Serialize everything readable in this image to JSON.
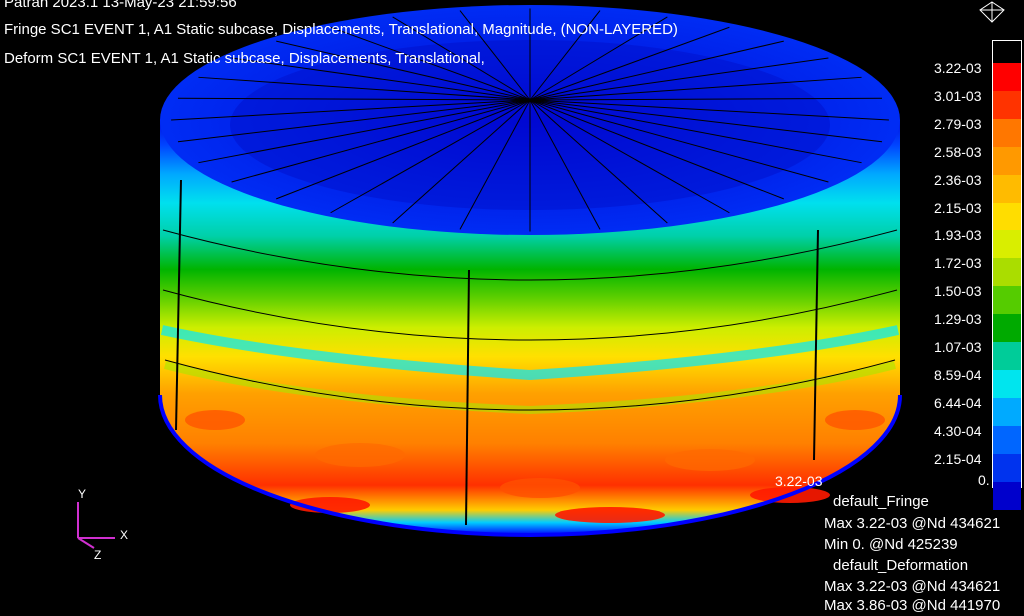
{
  "header": {
    "line1": "Patran 2023.1 13-May-23 21:59:56",
    "line2": "Fringe  SC1 EVENT 1, A1 Static subcase, Displacements, Translational, Magnitude, (NON-LAYERED)",
    "line3": "Deform  SC1 EVENT 1, A1 Static subcase, Displacements, Translational,"
  },
  "legend": {
    "labels": [
      "3.22-03",
      "3.01-03",
      "2.79-03",
      "2.58-03",
      "2.36-03",
      "2.15-03",
      "1.93-03",
      "1.72-03",
      "1.50-03",
      "1.29-03",
      "1.07-03",
      "8.59-04",
      "6.44-04",
      "4.30-04",
      "2.15-04",
      "0."
    ],
    "colors": [
      "#ff0000",
      "#ff3300",
      "#ff7700",
      "#ff9900",
      "#ffbb00",
      "#ffdd00",
      "#d9ee00",
      "#aadd00",
      "#55cc00",
      "#00aa00",
      "#00cc99",
      "#00e5ee",
      "#00aaff",
      "#0066ff",
      "#0033ee",
      "#0000cc"
    ]
  },
  "max_marker": "3.22-03",
  "triad": {
    "x": "X",
    "y": "Y",
    "z": "Z"
  },
  "stats": {
    "fringe_title": "default_Fringe",
    "fringe_max": "Max 3.22-03 @Nd 434621",
    "fringe_min": "Min  0. @Nd 425239",
    "deform_title": "default_Deformation",
    "deform_max": "Max 3.22-03 @Nd 434621",
    "deform_max2": "Max 3.86-03 @Nd 441970"
  }
}
